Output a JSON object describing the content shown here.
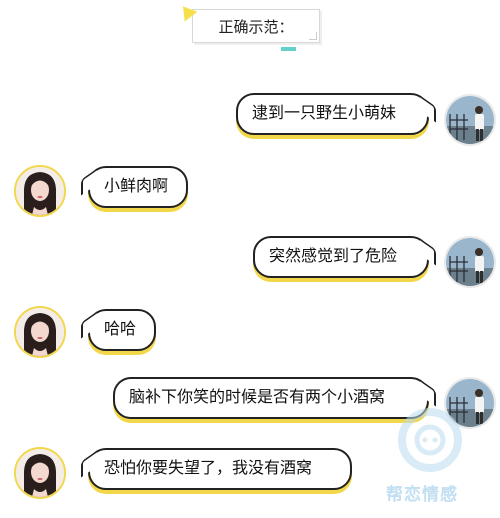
{
  "title": "正确示范：",
  "messages": [
    {
      "side": "right",
      "sender": "male",
      "text": "逮到一只野生小萌妹"
    },
    {
      "side": "left",
      "sender": "female",
      "text": "小鲜肉啊"
    },
    {
      "side": "right",
      "sender": "male",
      "text": "突然感觉到了危险"
    },
    {
      "side": "left",
      "sender": "female",
      "text": "哈哈"
    },
    {
      "side": "right",
      "sender": "male",
      "text": "脑补下你笑的时候是否有两个小酒窝"
    },
    {
      "side": "left",
      "sender": "female",
      "text": "恐怕你要失望了，我没有酒窝"
    }
  ],
  "watermark": {
    "text": "帮恋情感"
  },
  "colors": {
    "bubble_border": "#222222",
    "bubble_shadow": "#f2d74a",
    "title_accent": "#62d1cc",
    "watermark": "#8fc6e8"
  }
}
